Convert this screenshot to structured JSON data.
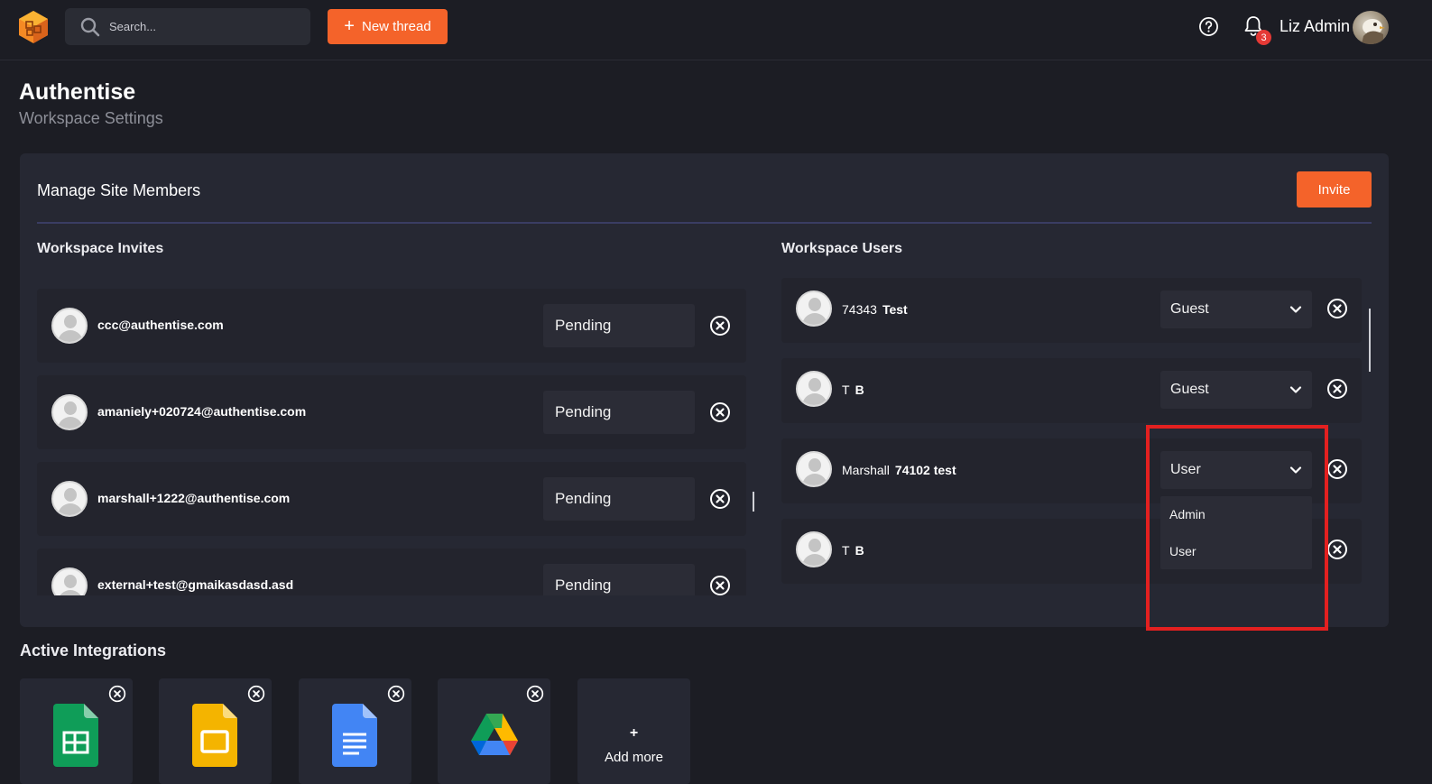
{
  "topbar": {
    "search_placeholder": "Search...",
    "new_thread_label": "New thread",
    "notification_count": "3",
    "user_name": "Liz Admin"
  },
  "page": {
    "title": "Authentise",
    "subtitle": "Workspace Settings"
  },
  "members": {
    "title": "Manage Site Members",
    "invite_label": "Invite",
    "invites_title": "Workspace Invites",
    "users_title": "Workspace Users",
    "invites": [
      {
        "email": "ccc@authentise.com",
        "status": "Pending"
      },
      {
        "email": "amaniely+020724@authentise.com",
        "status": "Pending"
      },
      {
        "email": "marshall+1222@authentise.com",
        "status": "Pending"
      },
      {
        "email": "external+test@gmaikasdasd.asd",
        "status": "Pending"
      }
    ],
    "users": [
      {
        "first": "74343",
        "last": "Test",
        "role": "Guest"
      },
      {
        "first": "T",
        "last": "B",
        "role": "Guest"
      },
      {
        "first": "Marshall",
        "last": "74102 test",
        "role": "User"
      },
      {
        "first": "T",
        "last": "B",
        "role": ""
      }
    ],
    "role_options": [
      "Admin",
      "User"
    ]
  },
  "integrations": {
    "title": "Active Integrations",
    "items": [
      {
        "name": "google-sheets-icon",
        "color": "#0f9d58"
      },
      {
        "name": "google-slides-icon",
        "color": "#f4b400"
      },
      {
        "name": "google-docs-icon",
        "color": "#4285f4"
      },
      {
        "name": "google-drive-icon",
        "color": "#34a853"
      }
    ],
    "add_more_plus": "+",
    "add_more_label": "Add more"
  },
  "colors": {
    "accent": "#f4632a",
    "background": "#1c1d24",
    "panel": "#262833",
    "highlight": "#e32020"
  }
}
